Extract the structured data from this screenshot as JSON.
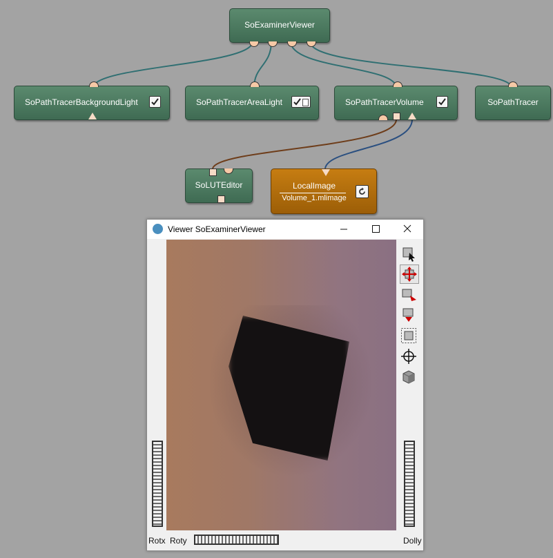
{
  "network": {
    "nodes": {
      "examiner": {
        "label": "SoExaminerViewer"
      },
      "bglight": {
        "label": "SoPathTracerBackgroundLight",
        "checked": true
      },
      "arealight": {
        "label": "SoPathTracerAreaLight",
        "checked": "partial"
      },
      "volume": {
        "label": "SoPathTracerVolume",
        "checked": true
      },
      "tracer": {
        "label": "SoPathTracer"
      },
      "luteditor": {
        "label": "SoLUTEditor"
      },
      "localimage": {
        "label": "LocalImage",
        "sublabel": "Volume_1.mlimage"
      }
    },
    "colors": {
      "module": "#4d7c60",
      "macro": "#b36f0d",
      "scene_wire": "#2f6f72",
      "lut_wire": "#6e3d1a",
      "image_wire": "#2a4f80"
    }
  },
  "viewer": {
    "title": "Viewer SoExaminerViewer",
    "tools": [
      "pick-icon",
      "rotate-icon",
      "seek-icon",
      "home-icon",
      "view-all-icon",
      "crosshair-icon",
      "cube-icon"
    ],
    "bottom": {
      "rotx": "Rotx",
      "roty": "Roty",
      "dolly": "Dolly"
    }
  }
}
